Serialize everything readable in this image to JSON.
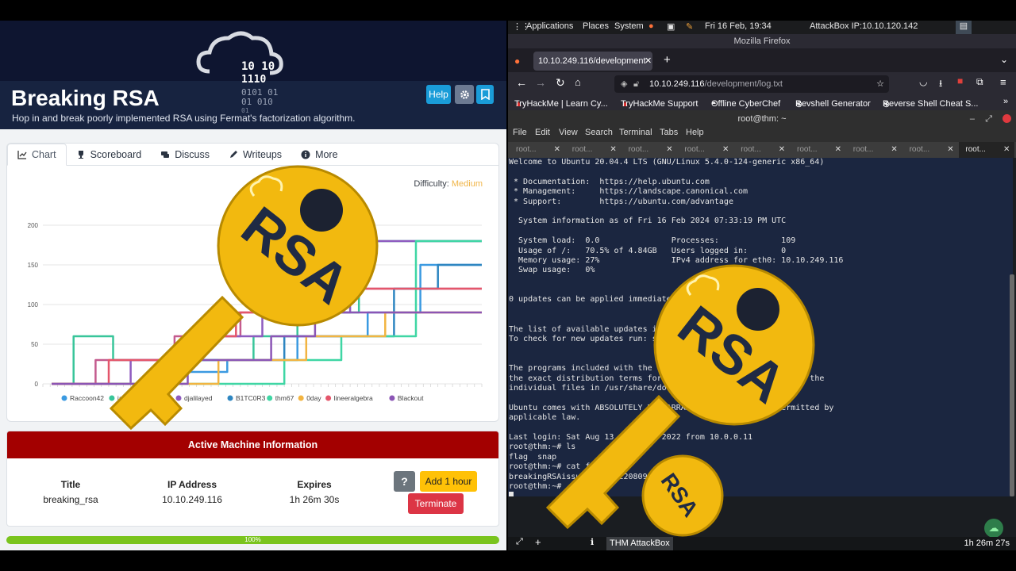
{
  "room": {
    "title": "Breaking RSA",
    "subtitle": "Hop in and break poorly implemented RSA using Fermat's factorization algorithm.",
    "help_label": "Help",
    "cloud_art_text": [
      "10 10",
      "1110",
      "0101 01",
      "01  010",
      "01"
    ],
    "tabs": [
      {
        "label": "Chart",
        "icon": "chart-icon"
      },
      {
        "label": "Scoreboard",
        "icon": "trophy-icon"
      },
      {
        "label": "Discuss",
        "icon": "comments-icon"
      },
      {
        "label": "Writeups",
        "icon": "pen-icon"
      },
      {
        "label": "More",
        "icon": "info-icon"
      }
    ],
    "difficulty_label": "Difficulty:",
    "difficulty_value": "Medium",
    "difficulty_color": "#f0b548",
    "machine": {
      "header": "Active Machine Information",
      "title_label": "Title",
      "title_value": "breaking_rsa",
      "ip_label": "IP Address",
      "ip_value": "10.10.249.116",
      "expires_label": "Expires",
      "expires_value": "1h 26m 30s",
      "help_label": "?",
      "add_label": "Add 1 hour",
      "terminate_label": "Terminate"
    },
    "progress": {
      "label": "100%",
      "value": 100
    }
  },
  "chart_data": {
    "type": "line",
    "ylim": [
      0,
      200
    ],
    "yticks": [
      "200",
      "150",
      "100",
      "50",
      "0"
    ],
    "series": [
      {
        "name": "Raccoon42",
        "color": "#3b9ae1",
        "steps": [
          [
            0.02,
            0
          ],
          [
            0.24,
            0
          ],
          [
            0.24,
            15
          ],
          [
            0.42,
            15
          ],
          [
            0.42,
            30
          ],
          [
            0.58,
            30
          ],
          [
            0.58,
            60
          ],
          [
            0.74,
            60
          ],
          [
            0.74,
            90
          ],
          [
            0.86,
            90
          ],
          [
            0.86,
            150
          ],
          [
            1,
            150
          ]
        ]
      },
      {
        "name": "jaxafed",
        "color": "#38c59a",
        "steps": [
          [
            0.02,
            0
          ],
          [
            0.07,
            0
          ],
          [
            0.07,
            60
          ],
          [
            0.16,
            60
          ],
          [
            0.16,
            30
          ],
          [
            0.48,
            30
          ],
          [
            0.48,
            60
          ],
          [
            0.58,
            60
          ],
          [
            0.58,
            90
          ],
          [
            0.72,
            90
          ],
          [
            0.72,
            180
          ],
          [
            1,
            180
          ]
        ]
      },
      {
        "name": "xb0b",
        "color": "#c45b8e",
        "steps": [
          [
            0.02,
            0
          ],
          [
            0.12,
            0
          ],
          [
            0.12,
            30
          ],
          [
            0.3,
            30
          ],
          [
            0.3,
            60
          ],
          [
            0.45,
            60
          ],
          [
            0.45,
            90
          ],
          [
            0.6,
            90
          ],
          [
            0.6,
            120
          ],
          [
            1,
            120
          ]
        ]
      },
      {
        "name": "djalilayed",
        "color": "#8e5bbf",
        "steps": [
          [
            0.02,
            0
          ],
          [
            0.2,
            0
          ],
          [
            0.2,
            30
          ],
          [
            0.34,
            30
          ],
          [
            0.34,
            60
          ],
          [
            0.5,
            60
          ],
          [
            0.5,
            90
          ],
          [
            0.7,
            90
          ],
          [
            0.7,
            180
          ],
          [
            1,
            180
          ]
        ]
      },
      {
        "name": "B1TC0R3",
        "color": "#2e86c1",
        "steps": [
          [
            0.02,
            0
          ],
          [
            0.28,
            0
          ],
          [
            0.28,
            30
          ],
          [
            0.55,
            30
          ],
          [
            0.55,
            60
          ],
          [
            0.8,
            60
          ],
          [
            0.8,
            120
          ],
          [
            0.9,
            120
          ],
          [
            0.9,
            150
          ],
          [
            1,
            150
          ]
        ]
      },
      {
        "name": "thm67",
        "color": "#3fd6a4",
        "steps": [
          [
            0.02,
            0
          ],
          [
            0.55,
            0
          ],
          [
            0.55,
            30
          ],
          [
            0.68,
            30
          ],
          [
            0.68,
            60
          ],
          [
            0.85,
            60
          ],
          [
            0.85,
            180
          ],
          [
            1,
            180
          ]
        ]
      },
      {
        "name": "0day",
        "color": "#f2b441",
        "steps": [
          [
            0.02,
            0
          ],
          [
            0.4,
            0
          ],
          [
            0.4,
            30
          ],
          [
            0.6,
            30
          ],
          [
            0.6,
            60
          ],
          [
            0.78,
            60
          ],
          [
            0.78,
            90
          ],
          [
            1,
            90
          ]
        ]
      },
      {
        "name": "lineeralgebra",
        "color": "#e4566b",
        "steps": [
          [
            0.02,
            0
          ],
          [
            0.15,
            0
          ],
          [
            0.15,
            30
          ],
          [
            0.35,
            30
          ],
          [
            0.35,
            60
          ],
          [
            0.44,
            60
          ],
          [
            0.44,
            90
          ],
          [
            0.66,
            90
          ],
          [
            0.66,
            120
          ],
          [
            1,
            120
          ]
        ]
      },
      {
        "name": "Blackout",
        "color": "#8b55b5",
        "steps": [
          [
            0.02,
            0
          ],
          [
            0.33,
            0
          ],
          [
            0.33,
            30
          ],
          [
            0.52,
            30
          ],
          [
            0.52,
            60
          ],
          [
            0.62,
            60
          ],
          [
            0.62,
            90
          ],
          [
            1,
            90
          ]
        ]
      }
    ]
  },
  "desktop": {
    "menu": [
      "Applications",
      "Places",
      "System"
    ],
    "clock": "Fri 16 Feb, 19:34",
    "attackbox_ip": "AttackBox IP:10.10.120.142",
    "window_title": "Mozilla Firefox",
    "tab_title": "10.10.249.116/development",
    "url_host": "10.10.249.116",
    "url_path": "/development/log.txt",
    "bookmarks": [
      "TryHackMe | Learn Cy...",
      "TryHackMe Support",
      "Offline CyberChef",
      "Revshell Generator",
      "Reverse Shell Cheat S..."
    ],
    "terminal_title": "root@thm: ~",
    "terminal_menu": [
      "File",
      "Edit",
      "View",
      "Search",
      "Terminal",
      "Tabs",
      "Help"
    ],
    "terminal_tabs": [
      "root...",
      "root...",
      "root...",
      "root...",
      "root...",
      "root...",
      "root...",
      "root...",
      "root..."
    ],
    "terminal_lines": [
      "Welcome to Ubuntu 20.04.4 LTS (GNU/Linux 5.4.0-124-generic x86_64)",
      "",
      " * Documentation:  https://help.ubuntu.com",
      " * Management:     https://landscape.canonical.com",
      " * Support:        https://ubuntu.com/advantage",
      "",
      "  System information as of Fri 16 Feb 2024 07:33:19 PM UTC",
      "",
      "  System load:  0.0               Processes:             109",
      "  Usage of /:   70.5% of 4.84GB   Users logged in:       0",
      "  Memory usage: 27%               IPv4 address for eth0: 10.10.249.116",
      "  Swap usage:   0%",
      "",
      "",
      "0 updates can be applied immediately.",
      "",
      "",
      "The list of available updates is more than a week old.",
      "To check for new updates run: sudo apt update",
      "",
      "",
      "The programs included with the Ubuntu system are free software;",
      "the exact distribution terms for each program are described in the",
      "individual files in /usr/share/doc/*/copyright.",
      "",
      "Ubuntu comes with ABSOLUTELY NO WARRANTY, to the extent permitted by",
      "applicable law.",
      "",
      "Last login: Sat Aug 13 11:47:12 2022 from 10.0.0.11",
      "root@thm:~# ls",
      "flag  snap",
      "root@thm:~# cat flag",
      "breakingRSAissuperfun20220809134031",
      "root@thm:~# "
    ],
    "taskbar_label": "THM AttackBox",
    "taskbar_time": "1h 26m 27s"
  },
  "overlay": {
    "key_text": "RSA",
    "key_color": "#f2b90f",
    "text_color": "#1f2a44"
  }
}
